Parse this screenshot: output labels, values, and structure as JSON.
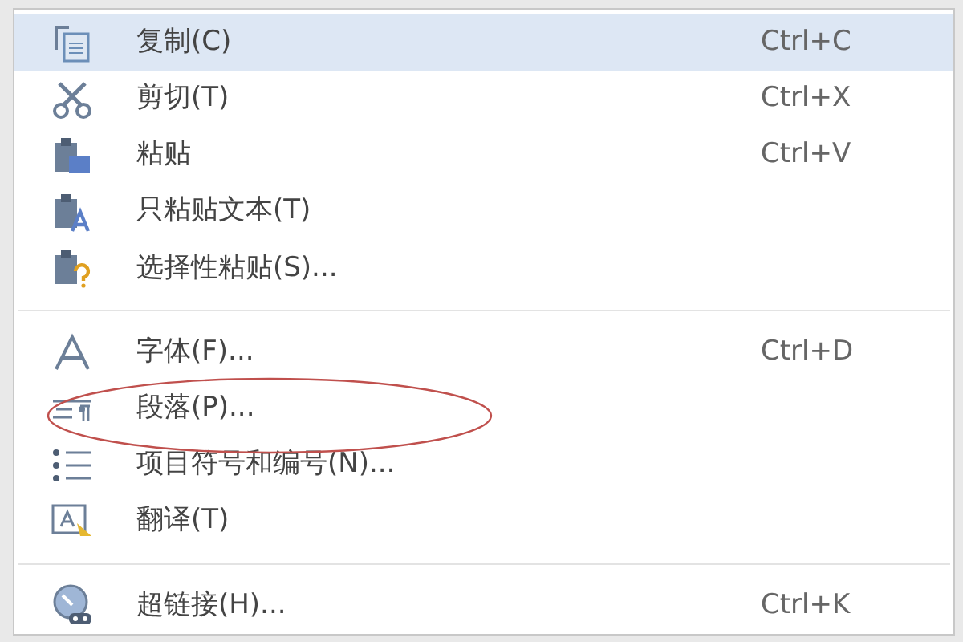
{
  "context_menu": {
    "items": [
      {
        "kind": "item",
        "label": "复制(C)",
        "shortcut": "Ctrl+C",
        "selected": true
      },
      {
        "kind": "item",
        "label": "剪切(T)",
        "shortcut": "Ctrl+X",
        "selected": false
      },
      {
        "kind": "item",
        "label": "粘贴",
        "shortcut": "Ctrl+V",
        "selected": false
      },
      {
        "kind": "item",
        "label": "只粘贴文本(T)",
        "selected": false
      },
      {
        "kind": "item",
        "label": "选择性粘贴(S)...",
        "selected": false
      },
      {
        "kind": "separator"
      },
      {
        "kind": "item",
        "label": "字体(F)...",
        "shortcut": "Ctrl+D",
        "selected": false
      },
      {
        "kind": "item",
        "label": "段落(P)...",
        "selected": false
      },
      {
        "kind": "item",
        "label": "项目符号和编号(N)...",
        "selected": false
      },
      {
        "kind": "item",
        "label": "翻译(T)",
        "selected": false
      },
      {
        "kind": "separator"
      },
      {
        "kind": "item",
        "label": "超链接(H)...",
        "shortcut": "Ctrl+K",
        "selected": false
      }
    ]
  }
}
